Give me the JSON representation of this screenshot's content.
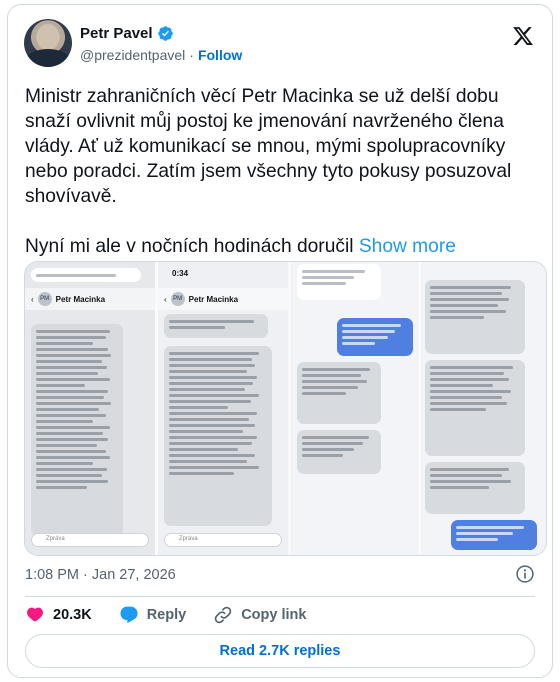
{
  "author": {
    "name": "Petr Pavel",
    "handle": "@prezidentpavel",
    "separator": "·",
    "follow_label": "Follow"
  },
  "tweet": {
    "paragraph1": "Ministr zahraničních věcí Petr Macinka se už delší dobu snaží ovlivnit můj postoj ke jmenování navrženého člena vlády. Ať už komunikací se mnou, mými spolupracovníky nebo poradci. Zatím jsem všechny tyto pokusy posuzoval shovívavě.",
    "paragraph2": "Nyní mi ale v nočních hodinách doručil",
    "show_more": "Show more"
  },
  "media": {
    "screenshot1": {
      "contact": "PM",
      "name": "Petr Macinka",
      "composer": "Zpráva"
    },
    "screenshot2": {
      "time": "0:34",
      "contact": "PM",
      "name": "Petr Macinka",
      "composer": "Zpráva"
    }
  },
  "footer": {
    "timestamp": "1:08 PM · Jan 27, 2026",
    "likes": "20.3K",
    "reply_label": "Reply",
    "copy_link_label": "Copy link",
    "read_replies": "Read 2.7K replies"
  },
  "colors": {
    "like_red": "#f91880",
    "reply_blue": "#1d9bf0",
    "link_blue": "#006fd6",
    "verified_blue": "#1d9bf0"
  }
}
